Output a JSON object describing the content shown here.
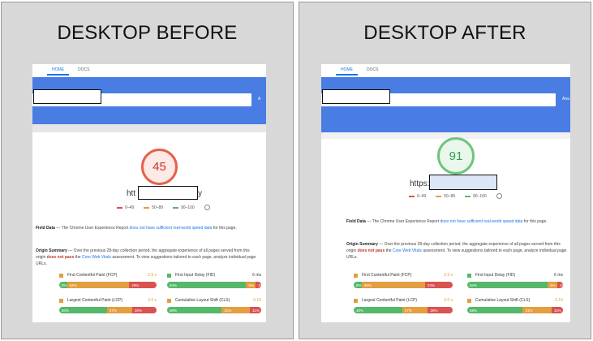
{
  "panels": {
    "before": {
      "title": "DESKTOP BEFORE",
      "tabs": [
        "HOME",
        "DOCS"
      ],
      "analyze_label": "A",
      "score": "45",
      "site_prefix": "htt",
      "site_suffix": "y",
      "colors": {
        "score_ring": "#e5614c",
        "score_fill": "#fde9e6",
        "score_text": "#c8382b"
      },
      "metrics": [
        {
          "label": "First Contentful Paint (FCP)",
          "value": "2.9 s",
          "value_color": "#e39e3f",
          "dot": "#e39e3f",
          "segments": [
            {
              "c": "g",
              "pct": 8,
              "text": "8%"
            },
            {
              "c": "o",
              "pct": 64,
              "text": "64%"
            },
            {
              "c": "r",
              "pct": 28,
              "text": "28%"
            }
          ]
        },
        {
          "label": "First Input Delay (FID)",
          "value": "6 ms",
          "value_color": "#333333",
          "dot": "#55b86a",
          "segments": [
            {
              "c": "g",
              "pct": 84,
              "text": "84%"
            },
            {
              "c": "o",
              "pct": 10,
              "text": "5%"
            },
            {
              "c": "r",
              "pct": 6,
              "text": "1%"
            }
          ]
        },
        {
          "label": "Largest Contentful Paint (LCP)",
          "value": "3.6 s",
          "value_color": "#e39e3f",
          "dot": "#e39e3f",
          "segments": [
            {
              "c": "g",
              "pct": 49,
              "text": "50%"
            },
            {
              "c": "o",
              "pct": 26,
              "text": "27%"
            },
            {
              "c": "r",
              "pct": 25,
              "text": "30%"
            }
          ]
        },
        {
          "label": "Cumulative Layout Shift (CLS)",
          "value": "0.16",
          "value_color": "#e39e3f",
          "dot": "#e39e3f",
          "segments": [
            {
              "c": "g",
              "pct": 58,
              "text": "58%"
            },
            {
              "c": "o",
              "pct": 30,
              "text": "31%"
            },
            {
              "c": "r",
              "pct": 12,
              "text": "11%"
            }
          ]
        }
      ]
    },
    "after": {
      "title": "DESKTOP AFTER",
      "tabs": [
        "HOME",
        "DOCS"
      ],
      "analyze_label": "Ana",
      "score": "91",
      "site_prefix": "https:",
      "site_suffix": "",
      "colors": {
        "score_ring": "#6fc47d",
        "score_fill": "#eaf7ec",
        "score_text": "#2e9d48"
      },
      "metrics": [
        {
          "label": "First Contentful Paint (FCP)",
          "value": "2.9 s",
          "value_color": "#e39e3f",
          "dot": "#e39e3f",
          "segments": [
            {
              "c": "g",
              "pct": 8,
              "text": "8%"
            },
            {
              "c": "o",
              "pct": 64,
              "text": "69%"
            },
            {
              "c": "r",
              "pct": 28,
              "text": "23%"
            }
          ]
        },
        {
          "label": "First Input Delay (FID)",
          "value": "6 ms",
          "value_color": "#333333",
          "dot": "#55b86a",
          "segments": [
            {
              "c": "g",
              "pct": 84,
              "text": "94%"
            },
            {
              "c": "o",
              "pct": 10,
              "text": "5%"
            },
            {
              "c": "r",
              "pct": 6,
              "text": "1%"
            }
          ]
        },
        {
          "label": "Largest Contentful Paint (LCP)",
          "value": "3.6 s",
          "value_color": "#e39e3f",
          "dot": "#e39e3f",
          "segments": [
            {
              "c": "g",
              "pct": 49,
              "text": "40%"
            },
            {
              "c": "o",
              "pct": 26,
              "text": "27%"
            },
            {
              "c": "r",
              "pct": 25,
              "text": "28%"
            }
          ]
        },
        {
          "label": "Cumulative Layout Shift (CLS)",
          "value": "0.16",
          "value_color": "#e39e3f",
          "dot": "#e39e3f",
          "segments": [
            {
              "c": "g",
              "pct": 58,
              "text": "58%"
            },
            {
              "c": "o",
              "pct": 30,
              "text": "31%"
            },
            {
              "c": "r",
              "pct": 12,
              "text": "11%"
            }
          ]
        }
      ]
    }
  },
  "legend": [
    {
      "label": "0–49",
      "color": "#d9534f"
    },
    {
      "label": "50–89",
      "color": "#e39e3f"
    },
    {
      "label": "90–100",
      "color": "#55b86a"
    }
  ],
  "field_data": {
    "heading": "Field Data",
    "text_a": " — The Chrome User Experience Report ",
    "text_link": "does not have sufficient real-world speed data",
    "text_b": " for this page."
  },
  "origin_summary": {
    "heading": "Origin Summary",
    "text_a": " — Over the previous 28-day collection period, the aggregate experience of all pages served from this origin ",
    "text_red": "does not pass",
    "text_b": " the ",
    "text_link": "Core Web Vitals",
    "text_c": " assessment. To view suggestions tailored to each page, analyze individual page URLs."
  }
}
